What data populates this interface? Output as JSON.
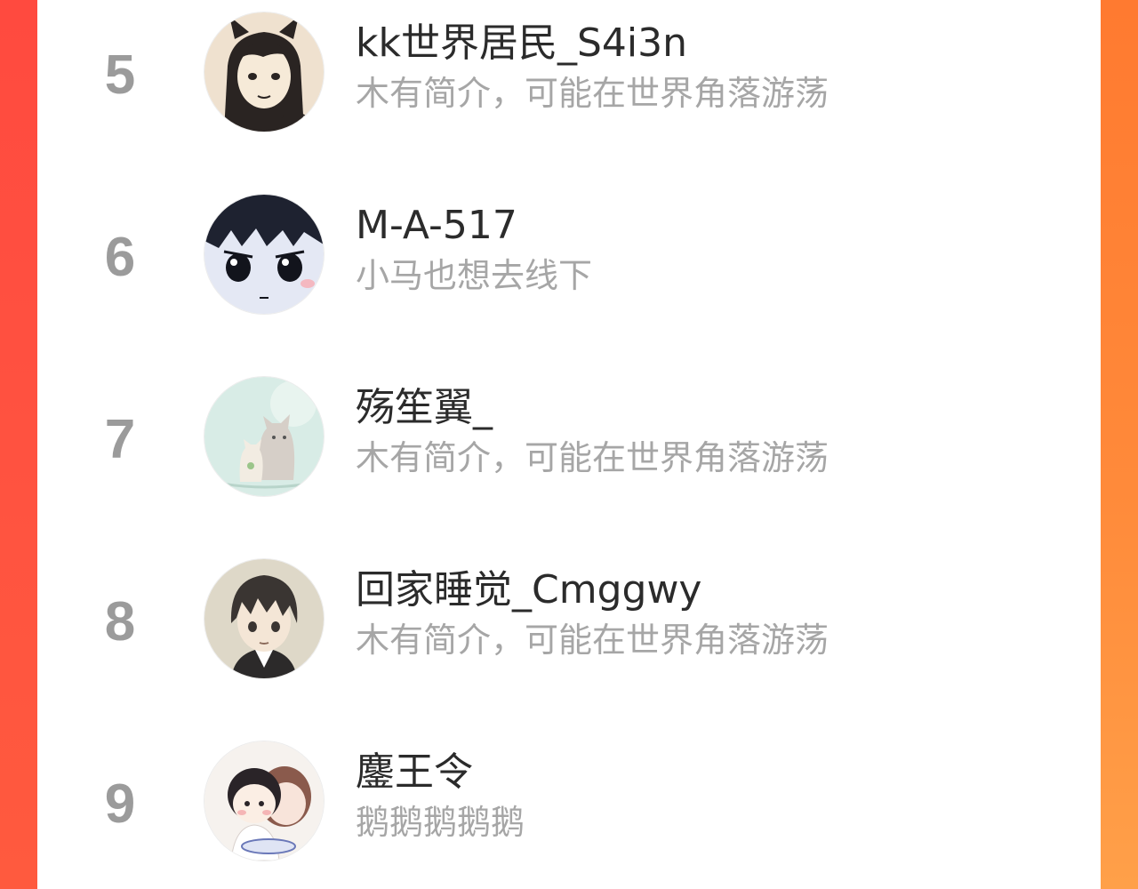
{
  "ranking": {
    "rows": [
      {
        "rank": "5",
        "name": "kk世界居民_S4i3n",
        "bio": "木有简介，可能在世界角落游荡",
        "avatar_icon": "sketch-girl-avatar"
      },
      {
        "rank": "6",
        "name": "M-A-517",
        "bio": "小马也想去线下",
        "avatar_icon": "anime-boy-closeup-avatar"
      },
      {
        "rank": "7",
        "name": "殇笙翼_",
        "bio": "木有简介，可能在世界角落游荡",
        "avatar_icon": "cats-avatar"
      },
      {
        "rank": "8",
        "name": "回家睡觉_Cmggwy",
        "bio": "木有简介，可能在世界角落游荡",
        "avatar_icon": "anime-boy-avatar"
      },
      {
        "rank": "9",
        "name": "鏖王令",
        "bio": "鹅鹅鹅鹅鹅",
        "avatar_icon": "chibi-couple-avatar"
      }
    ]
  },
  "colors": {
    "rank_number": "#9b9b9b",
    "name_text": "#2b2b2b",
    "bio_text": "#a6a6a6",
    "frame_left": "#ff4a3f",
    "frame_right": "#ff8a3a",
    "panel": "#ffffff"
  }
}
